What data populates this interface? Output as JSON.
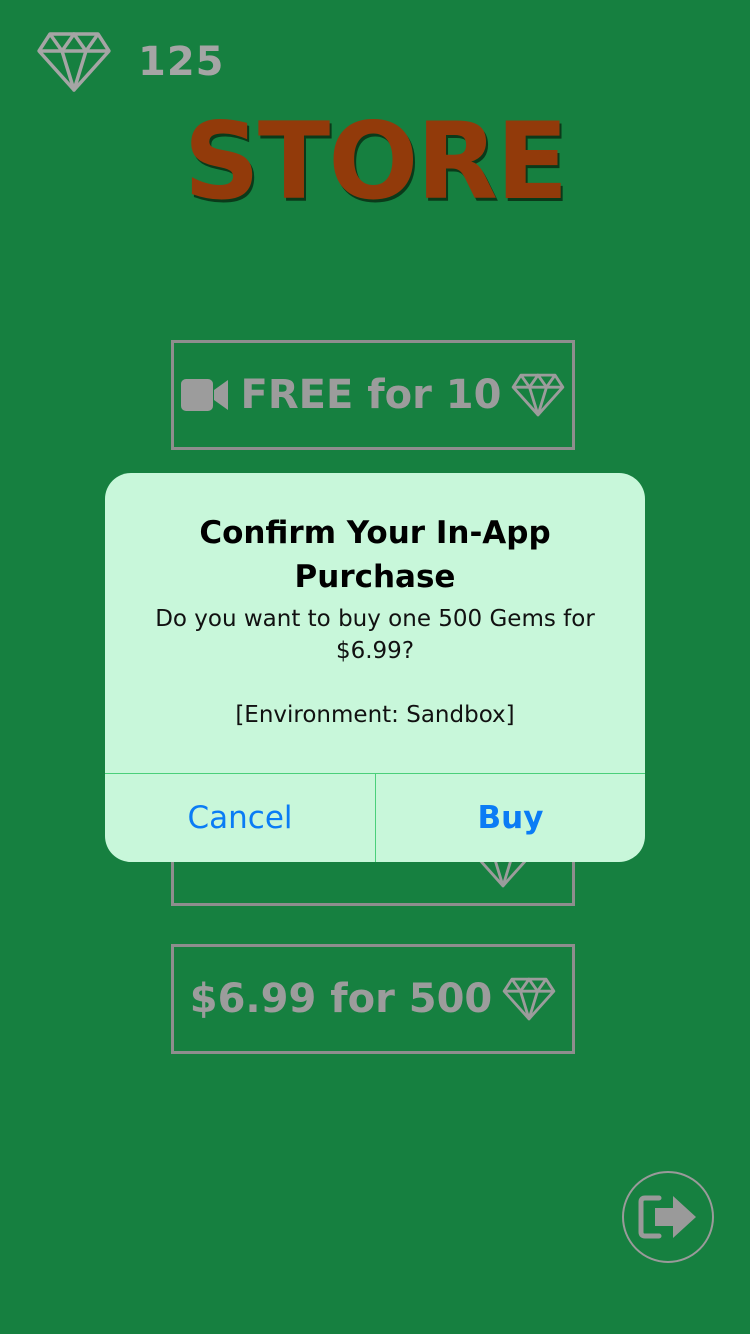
{
  "header": {
    "gem_count": "125",
    "title": "STORE"
  },
  "store_buttons": [
    {
      "label": "FREE for 10",
      "icon_left": "video-camera-icon",
      "icon_right": "gem-icon"
    },
    {
      "label": "$6.99 for 500",
      "icon_right": "gem-icon"
    }
  ],
  "dialog": {
    "title": "Confirm Your In-App Purchase",
    "message": "Do you want to buy one 500 Gems for $6.99?",
    "environment": "[Environment: Sandbox]",
    "cancel_label": "Cancel",
    "buy_label": "Buy"
  },
  "icons": {
    "gem": "gem-icon",
    "exit": "exit-arrow-icon",
    "video": "video-camera-icon"
  },
  "colors": {
    "background": "#168040",
    "title": "#923a0a",
    "muted": "#9c9c9c",
    "dialog_bg": "#c8f7da",
    "dialog_button": "#0a7cf5",
    "dialog_divider": "#4ad07a"
  }
}
